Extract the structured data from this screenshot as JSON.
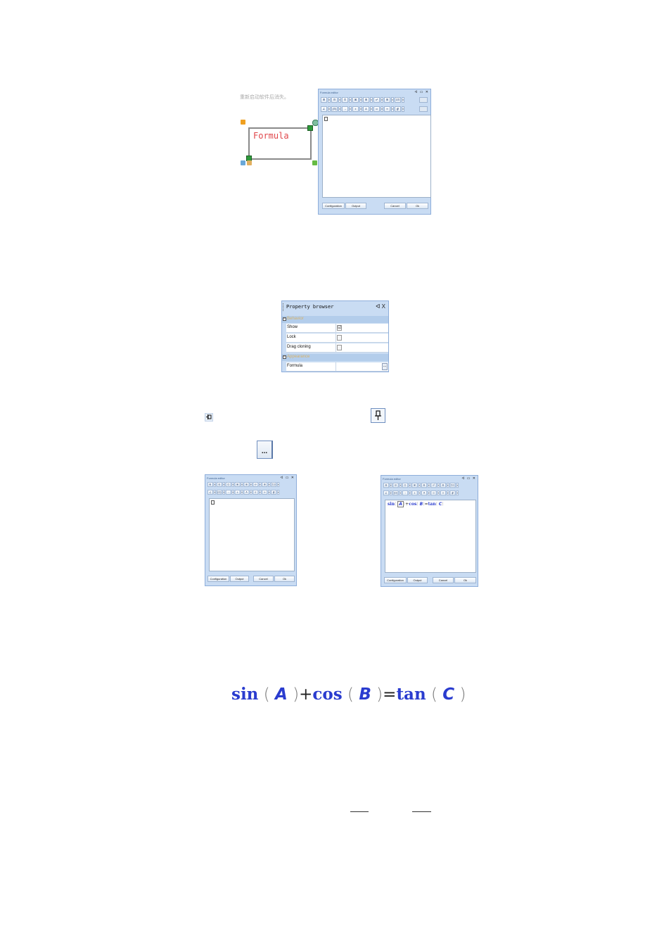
{
  "widget": {
    "hint_text": "重新启动软件后消失。",
    "box_label": "Formula"
  },
  "formula_editor": {
    "title": "Formula editor",
    "title_controls": "ᐊ ▭ ✕",
    "toolbar_row1": [
      "⊞",
      "⊟",
      "⊡",
      "⊠",
      "⊞",
      "x²",
      "⊞",
      "Σ⊡"
    ],
    "toolbar_row2": [
      "∠",
      "(⊡)",
      "→",
      "±",
      "A",
      "α",
      "∞",
      "∯"
    ],
    "buttons": {
      "configuration": "Configuration",
      "output": "Output",
      "cancel": "Cancel",
      "ok": "Ok"
    }
  },
  "property_browser": {
    "title": "Property browser",
    "title_controls": "ᐊ X",
    "categories": [
      {
        "name": "Behavior",
        "rows": [
          {
            "label": "Show",
            "checked": "☑"
          },
          {
            "label": "Lock",
            "checked": ""
          },
          {
            "label": "Drag cloning",
            "checked": ""
          }
        ]
      },
      {
        "name": "Appearance",
        "rows": [
          {
            "label": "Formula",
            "value": "..."
          }
        ]
      }
    ]
  },
  "ellipsis_button": "...",
  "formula_preview": {
    "sin": "sin",
    "cos": "cos",
    "tan": "tan",
    "a": "A",
    "b": "B",
    "c": "C",
    "plus": "+",
    "equals": "=",
    "open": "(",
    "close": ")"
  }
}
